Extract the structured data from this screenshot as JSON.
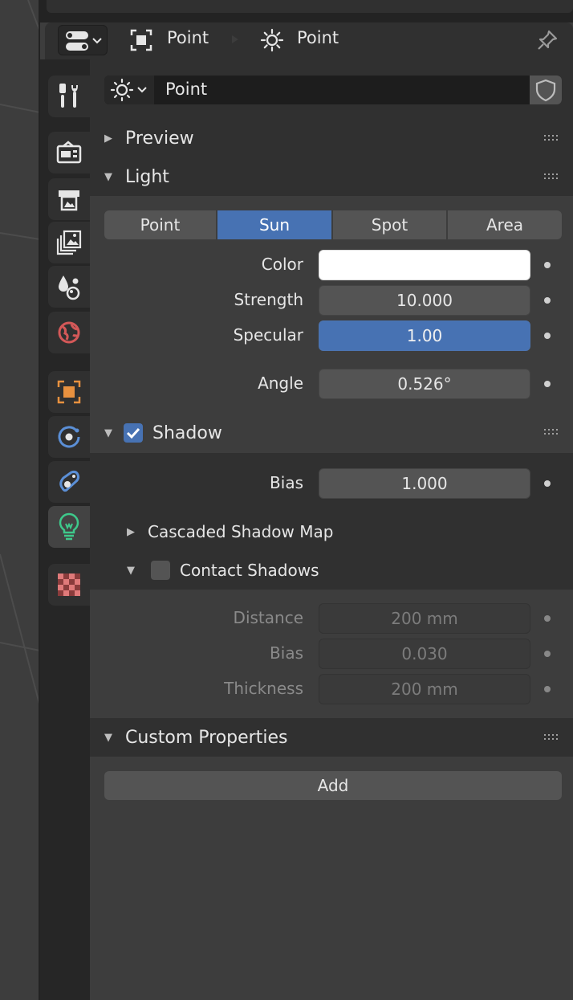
{
  "header": {
    "object_name": "Point",
    "data_name": "Point",
    "icons": [
      "editor-type-icon",
      "object-icon",
      "light-data-icon",
      "pin-icon"
    ]
  },
  "datablock": {
    "name": "Point",
    "icons": [
      "light-data-icon",
      "fake-user-shield-icon"
    ]
  },
  "tabs": [
    {
      "name": "tool",
      "icon": "wrench-screwdriver-icon"
    },
    {
      "name": "render",
      "icon": "camera-back-icon"
    },
    {
      "name": "output",
      "icon": "printer-icon"
    },
    {
      "name": "view-layer",
      "icon": "image-stack-icon"
    },
    {
      "name": "scene",
      "icon": "scene-icon"
    },
    {
      "name": "world",
      "icon": "world-icon"
    },
    {
      "name": "object",
      "icon": "object-square-icon"
    },
    {
      "name": "physics",
      "icon": "physics-icon"
    },
    {
      "name": "constraints",
      "icon": "constraint-icon"
    },
    {
      "name": "light-data",
      "icon": "bulb-icon",
      "active": true
    },
    {
      "name": "texture",
      "icon": "checker-icon"
    }
  ],
  "panels": {
    "preview": {
      "title": "Preview",
      "expanded": false
    },
    "light": {
      "title": "Light",
      "expanded": true,
      "types": [
        "Point",
        "Sun",
        "Spot",
        "Area"
      ],
      "selected_type": "Sun",
      "props": {
        "color_label": "Color",
        "color_value": "#ffffff",
        "strength_label": "Strength",
        "strength_value": "10.000",
        "specular_label": "Specular",
        "specular_value": "1.00",
        "angle_label": "Angle",
        "angle_value": "0.526°"
      }
    },
    "shadow": {
      "title": "Shadow",
      "enabled": true,
      "bias_label": "Bias",
      "bias_value": "1.000",
      "cascaded": {
        "title": "Cascaded Shadow Map",
        "expanded": false
      },
      "contact": {
        "title": "Contact Shadows",
        "enabled": false,
        "expanded": true,
        "distance_label": "Distance",
        "distance_value": "200 mm",
        "bias_label": "Bias",
        "bias_value": "0.030",
        "thickness_label": "Thickness",
        "thickness_value": "200 mm"
      }
    },
    "custom_properties": {
      "title": "Custom Properties",
      "expanded": true,
      "add_label": "Add"
    }
  },
  "colors": {
    "accent": "#4772b3",
    "panel": "#303030",
    "header": "#3d3d3d",
    "field": "#545454",
    "active_tab_icon": "#3ec98b",
    "object_icon": "#e8913f",
    "world_icon": "#d45858",
    "physics_icon": "#5b8fd6"
  }
}
